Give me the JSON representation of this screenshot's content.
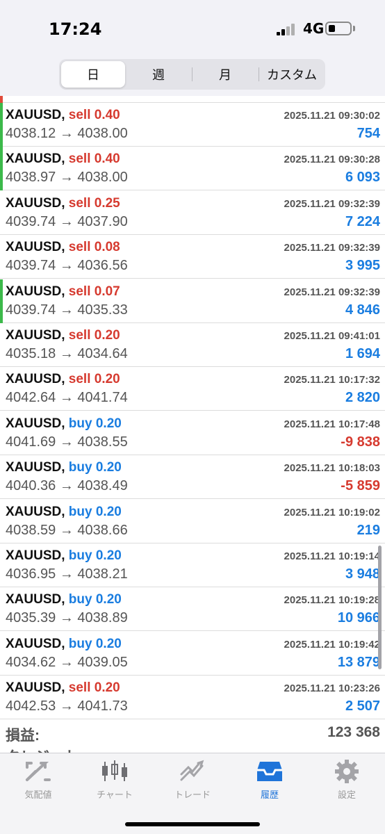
{
  "status_bar": {
    "time": "17:24",
    "network": "4G"
  },
  "period_tabs": [
    {
      "label": "日",
      "active": true
    },
    {
      "label": "週",
      "active": false
    },
    {
      "label": "月",
      "active": false
    },
    {
      "label": "カスタム",
      "active": false
    }
  ],
  "colors": {
    "sell": "#d63a2f",
    "buy": "#1a7de0",
    "profit": "#1a7de0",
    "loss": "#d63a2f",
    "marker_green": "#3cb94a",
    "marker_red": "#e04a3a",
    "active_tab": "#1f74d9"
  },
  "trades": [
    {
      "symbol": "XAUUSD,",
      "side": "sell",
      "volume": "sell 0.40",
      "prices": "4038.12 → 4038.00",
      "datetime": "2025.11.21 09:30:02",
      "profit": "754",
      "profit_sign": "pos",
      "marker": "green"
    },
    {
      "symbol": "XAUUSD,",
      "side": "sell",
      "volume": "sell 0.40",
      "prices": "4038.97 → 4038.00",
      "datetime": "2025.11.21 09:30:28",
      "profit": "6 093",
      "profit_sign": "pos",
      "marker": "green"
    },
    {
      "symbol": "XAUUSD,",
      "side": "sell",
      "volume": "sell 0.25",
      "prices": "4039.74 → 4037.90",
      "datetime": "2025.11.21 09:32:39",
      "profit": "7 224",
      "profit_sign": "pos",
      "marker": "none"
    },
    {
      "symbol": "XAUUSD,",
      "side": "sell",
      "volume": "sell 0.08",
      "prices": "4039.74 → 4036.56",
      "datetime": "2025.11.21 09:32:39",
      "profit": "3 995",
      "profit_sign": "pos",
      "marker": "none"
    },
    {
      "symbol": "XAUUSD,",
      "side": "sell",
      "volume": "sell 0.07",
      "prices": "4039.74 → 4035.33",
      "datetime": "2025.11.21 09:32:39",
      "profit": "4 846",
      "profit_sign": "pos",
      "marker": "green"
    },
    {
      "symbol": "XAUUSD,",
      "side": "sell",
      "volume": "sell 0.20",
      "prices": "4035.18 → 4034.64",
      "datetime": "2025.11.21 09:41:01",
      "profit": "1 694",
      "profit_sign": "pos",
      "marker": "none"
    },
    {
      "symbol": "XAUUSD,",
      "side": "sell",
      "volume": "sell 0.20",
      "prices": "4042.64 → 4041.74",
      "datetime": "2025.11.21 10:17:32",
      "profit": "2 820",
      "profit_sign": "pos",
      "marker": "none"
    },
    {
      "symbol": "XAUUSD,",
      "side": "buy",
      "volume": "buy 0.20",
      "prices": "4041.69 → 4038.55",
      "datetime": "2025.11.21 10:17:48",
      "profit": "-9 838",
      "profit_sign": "neg",
      "marker": "none"
    },
    {
      "symbol": "XAUUSD,",
      "side": "buy",
      "volume": "buy 0.20",
      "prices": "4040.36 → 4038.49",
      "datetime": "2025.11.21 10:18:03",
      "profit": "-5 859",
      "profit_sign": "neg",
      "marker": "none"
    },
    {
      "symbol": "XAUUSD,",
      "side": "buy",
      "volume": "buy 0.20",
      "prices": "4038.59 → 4038.66",
      "datetime": "2025.11.21 10:19:02",
      "profit": "219",
      "profit_sign": "pos",
      "marker": "none"
    },
    {
      "symbol": "XAUUSD,",
      "side": "buy",
      "volume": "buy 0.20",
      "prices": "4036.95 → 4038.21",
      "datetime": "2025.11.21 10:19:14",
      "profit": "3 948",
      "profit_sign": "pos",
      "marker": "none"
    },
    {
      "symbol": "XAUUSD,",
      "side": "buy",
      "volume": "buy 0.20",
      "prices": "4035.39 → 4038.89",
      "datetime": "2025.11.21 10:19:28",
      "profit": "10 966",
      "profit_sign": "pos",
      "marker": "none"
    },
    {
      "symbol": "XAUUSD,",
      "side": "buy",
      "volume": "buy 0.20",
      "prices": "4034.62 → 4039.05",
      "datetime": "2025.11.21 10:19:42",
      "profit": "13 879",
      "profit_sign": "pos",
      "marker": "none"
    },
    {
      "symbol": "XAUUSD,",
      "side": "sell",
      "volume": "sell 0.20",
      "prices": "4042.53 → 4041.73",
      "datetime": "2025.11.21 10:23:26",
      "profit": "2 507",
      "profit_sign": "pos",
      "marker": "none"
    }
  ],
  "summary": {
    "label": "損益:",
    "value": "123 368",
    "credit_label": "クレジット"
  },
  "tab_bar": [
    {
      "label": "気配値",
      "icon": "quotes-icon",
      "active": false
    },
    {
      "label": "チャート",
      "icon": "chart-icon",
      "active": false
    },
    {
      "label": "トレード",
      "icon": "trade-icon",
      "active": false
    },
    {
      "label": "履歴",
      "icon": "history-icon",
      "active": true
    },
    {
      "label": "設定",
      "icon": "settings-icon",
      "active": false
    }
  ]
}
